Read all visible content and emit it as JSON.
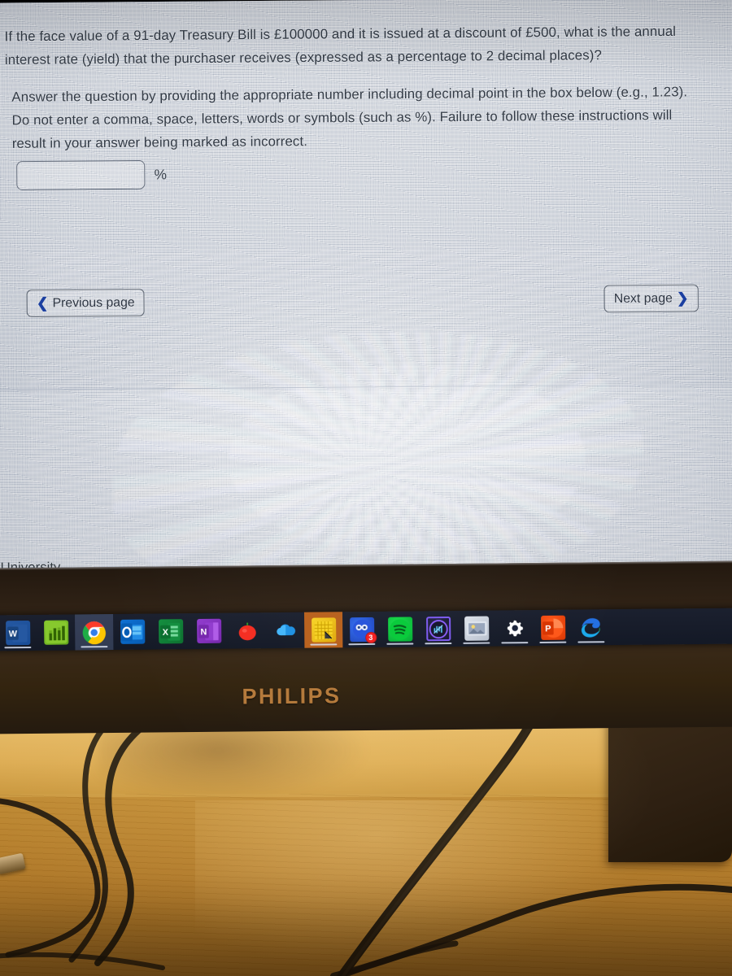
{
  "screen": {
    "question": {
      "paragraph_1": "If the face value of a 91-day Treasury Bill is £100000 and it is issued at a discount of £500, what is the annual interest rate (yield) that the purchaser receives (expressed as a percentage to 2 decimal places)?",
      "paragraph_2": "Answer the question by providing the appropriate number including decimal point in the box below (e.g., 1.23). Do not enter a comma, space, letters, words or symbols (such as %). Failure to follow these instructions will result in your answer being marked as incorrect."
    },
    "answer": {
      "value": "",
      "placeholder": "",
      "unit_label": "%"
    },
    "navigation": {
      "previous_label": "Previous page",
      "previous_icon": "chevron-left-icon",
      "next_label": "Next page",
      "next_icon": "chevron-right-icon"
    },
    "footer_text": "University",
    "colors": {
      "background": "#c9ced6",
      "text": "#323a45",
      "chevron_blue": "#1b3fa0",
      "border": "#5e6672"
    }
  },
  "taskbar": {
    "items": [
      {
        "name": "word",
        "icon": "word-icon",
        "glyph": "W",
        "running": true,
        "active": false,
        "badge": ""
      },
      {
        "name": "stats-app",
        "icon": "bar-chart-icon",
        "glyph": "▮▯▮",
        "running": false,
        "active": false,
        "badge": ""
      },
      {
        "name": "chrome",
        "icon": "chrome-icon",
        "glyph": "",
        "running": true,
        "active": true,
        "badge": ""
      },
      {
        "name": "outlook",
        "icon": "outlook-icon",
        "glyph": "O",
        "running": false,
        "active": false,
        "badge": ""
      },
      {
        "name": "excel",
        "icon": "excel-icon",
        "glyph": "X",
        "running": false,
        "active": false,
        "badge": ""
      },
      {
        "name": "onenote",
        "icon": "onenote-icon",
        "glyph": "N",
        "running": false,
        "active": false,
        "badge": ""
      },
      {
        "name": "pomodoro",
        "icon": "tomato-icon",
        "glyph": "",
        "running": false,
        "active": false,
        "badge": ""
      },
      {
        "name": "onedrive",
        "icon": "cloud-icon",
        "glyph": "",
        "running": false,
        "active": false,
        "badge": ""
      },
      {
        "name": "notepad",
        "icon": "notepad-icon",
        "glyph": "",
        "running": true,
        "active": false,
        "badge": ""
      },
      {
        "name": "messages",
        "icon": "messages-circle-icon",
        "glyph": "",
        "running": true,
        "active": false,
        "badge": "3"
      },
      {
        "name": "spotify",
        "icon": "spotify-icon",
        "glyph": "",
        "running": true,
        "active": false,
        "badge": ""
      },
      {
        "name": "audio-app",
        "icon": "headphone-ring-icon",
        "glyph": "",
        "running": true,
        "active": false,
        "badge": ""
      },
      {
        "name": "photos",
        "icon": "photo-icon",
        "glyph": "",
        "running": true,
        "active": false,
        "badge": ""
      },
      {
        "name": "settings",
        "icon": "gear-icon",
        "glyph": "✲",
        "running": true,
        "active": false,
        "badge": ""
      },
      {
        "name": "powerpoint",
        "icon": "powerpoint-icon",
        "glyph": "P",
        "running": true,
        "active": false,
        "badge": ""
      },
      {
        "name": "edge",
        "icon": "edge-icon",
        "glyph": "",
        "running": true,
        "active": false,
        "badge": ""
      }
    ]
  },
  "monitor": {
    "brand": "PHILIPS",
    "bezel_color": "#2f2212",
    "logo_color": "#b4793a"
  }
}
